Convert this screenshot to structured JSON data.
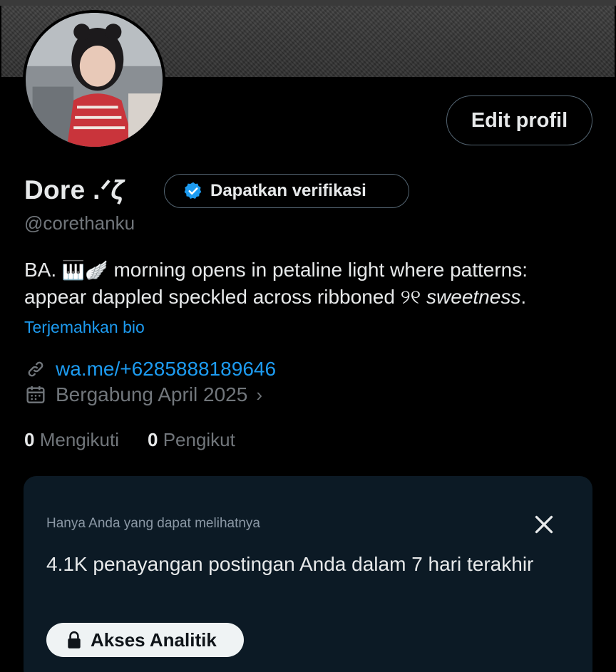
{
  "profile": {
    "display_name": "Dore .ᐟ𝜁",
    "handle": "@corethanku",
    "edit_button": "Edit profil",
    "verify_button": "Dapatkan verifikasi",
    "bio": {
      "prefix": "BA.",
      "emoji_1": "🎹🪽",
      "text_1": " morning opens in petaline light where patterns: appear dappled speckled across ribboned ",
      "glyph": "୨୧",
      "text_2": "sweetness",
      "suffix": "."
    },
    "translate_link": "Terjemahkan bio",
    "website": "wa.me/+6285888189646",
    "joined": "Bergabung April 2025",
    "following_count": "0",
    "following_label": "Mengikuti",
    "followers_count": "0",
    "followers_label": "Pengikut"
  },
  "insight_card": {
    "privacy_note": "Hanya Anda yang dapat melihatnya",
    "message": "4.1K penayangan postingan Anda dalam 7 hari terakhir",
    "button_label": "Akses Analitik"
  },
  "icons": {
    "verify": "verified-badge-icon",
    "link": "link-icon",
    "calendar": "calendar-icon",
    "close": "close-icon",
    "lock": "lock-icon"
  },
  "colors": {
    "background": "#000000",
    "link": "#1d9bf0",
    "muted": "#71767b",
    "card": "#0c1a25",
    "border": "#536471"
  }
}
